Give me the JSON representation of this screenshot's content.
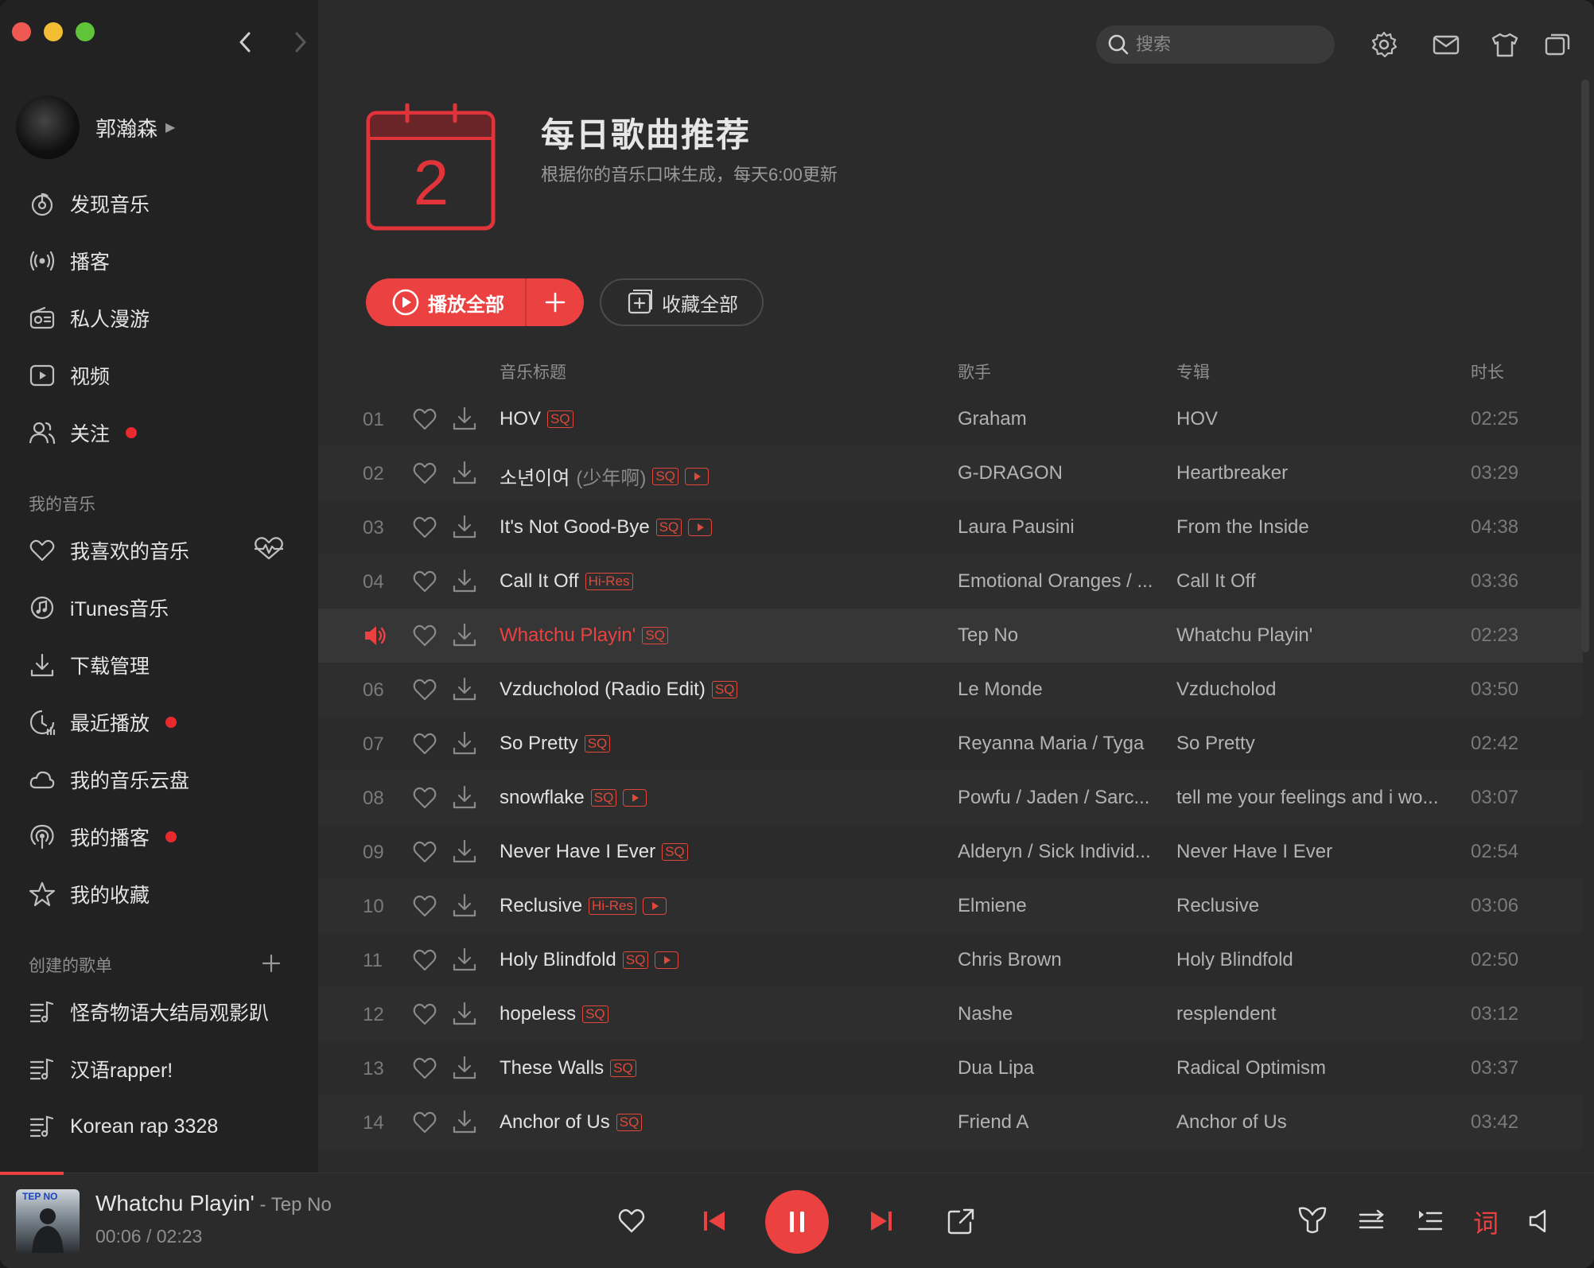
{
  "colors": {
    "accent": "#ec4141",
    "sidebar_bg": "#222222",
    "main_bg": "#2b2b2b",
    "text_primary": "#e2e2e2",
    "text_secondary": "#9a9a9a"
  },
  "titlebar": {
    "search_placeholder": "搜索",
    "icons": [
      "back-arrow-icon",
      "forward-arrow-icon",
      "settings-icon",
      "mail-icon",
      "skin-icon",
      "mini-mode-icon"
    ]
  },
  "sidebar": {
    "user_name": "郭瀚森",
    "nav": [
      {
        "label": "发现音乐",
        "icon": "discover-icon",
        "dot": false
      },
      {
        "label": "播客",
        "icon": "podcast-icon",
        "dot": false
      },
      {
        "label": "私人漫游",
        "icon": "radio-icon",
        "dot": false
      },
      {
        "label": "视频",
        "icon": "video-icon",
        "dot": false
      },
      {
        "label": "关注",
        "icon": "follow-icon",
        "dot": true
      }
    ],
    "my_music_label": "我的音乐",
    "my_music": [
      {
        "label": "我喜欢的音乐",
        "icon": "heart-icon",
        "dot": false
      },
      {
        "label": "iTunes音乐",
        "icon": "itunes-icon",
        "dot": false
      },
      {
        "label": "下载管理",
        "icon": "download-icon",
        "dot": false
      },
      {
        "label": "最近播放",
        "icon": "recent-icon",
        "dot": true
      },
      {
        "label": "我的音乐云盘",
        "icon": "cloud-icon",
        "dot": false
      },
      {
        "label": "我的播客",
        "icon": "my-podcast-icon",
        "dot": true
      },
      {
        "label": "我的收藏",
        "icon": "star-icon",
        "dot": false
      }
    ],
    "created_label": "创建的歌单",
    "playlists": [
      {
        "label": "怪奇物语大结局观影趴"
      },
      {
        "label": "汉语rapper!"
      },
      {
        "label": "Korean rap  3328"
      }
    ]
  },
  "header": {
    "calendar_day": "2",
    "title": "每日歌曲推荐",
    "subtitle": "根据你的音乐口味生成，每天6:00更新",
    "play_all_label": "播放全部",
    "collect_all_label": "收藏全部"
  },
  "table": {
    "columns": {
      "title": "音乐标题",
      "artist": "歌手",
      "album": "专辑",
      "duration": "时长"
    },
    "rows": [
      {
        "num": "01",
        "title": "HOV",
        "alias": "",
        "tag": "SQ",
        "mv": false,
        "artist": "Graham",
        "album": "HOV",
        "duration": "02:25",
        "playing": false
      },
      {
        "num": "02",
        "title": "소년이여",
        "alias": "(少年啊)",
        "tag": "SQ",
        "mv": true,
        "artist": "G-DRAGON",
        "album": "Heartbreaker",
        "duration": "03:29",
        "playing": false
      },
      {
        "num": "03",
        "title": "It's Not Good-Bye",
        "alias": "",
        "tag": "SQ",
        "mv": true,
        "artist": "Laura Pausini",
        "album": "From the Inside",
        "duration": "04:38",
        "playing": false
      },
      {
        "num": "04",
        "title": "Call It Off",
        "alias": "",
        "tag": "Hi-Res",
        "mv": false,
        "artist": "Emotional Oranges / ...",
        "album": "Call It Off",
        "duration": "03:36",
        "playing": false
      },
      {
        "num": "05",
        "title": "Whatchu Playin'",
        "alias": "",
        "tag": "SQ",
        "mv": false,
        "artist": "Tep No",
        "album": "Whatchu Playin'",
        "duration": "02:23",
        "playing": true
      },
      {
        "num": "06",
        "title": "Vzducholod (Radio Edit)",
        "alias": "",
        "tag": "SQ",
        "mv": false,
        "artist": "Le Monde",
        "album": "Vzducholod",
        "duration": "03:50",
        "playing": false
      },
      {
        "num": "07",
        "title": "So Pretty",
        "alias": "",
        "tag": "SQ",
        "mv": false,
        "artist": "Reyanna Maria / Tyga",
        "album": "So Pretty",
        "duration": "02:42",
        "playing": false
      },
      {
        "num": "08",
        "title": "snowflake",
        "alias": "",
        "tag": "SQ",
        "mv": true,
        "artist": "Powfu / Jaden / Sarc...",
        "album": "tell me your feelings and i wo...",
        "duration": "03:07",
        "playing": false
      },
      {
        "num": "09",
        "title": "Never Have I Ever",
        "alias": "",
        "tag": "SQ",
        "mv": false,
        "artist": "Alderyn / Sick Individ...",
        "album": "Never Have I Ever",
        "duration": "02:54",
        "playing": false
      },
      {
        "num": "10",
        "title": "Reclusive",
        "alias": "",
        "tag": "Hi-Res",
        "mv": true,
        "artist": "Elmiene",
        "album": "Reclusive",
        "duration": "03:06",
        "playing": false
      },
      {
        "num": "11",
        "title": "Holy Blindfold",
        "alias": "",
        "tag": "SQ",
        "mv": true,
        "artist": "Chris Brown",
        "album": "Holy Blindfold",
        "duration": "02:50",
        "playing": false
      },
      {
        "num": "12",
        "title": "hopeless",
        "alias": "",
        "tag": "SQ",
        "mv": false,
        "artist": "Nashe",
        "album": "resplendent",
        "duration": "03:12",
        "playing": false
      },
      {
        "num": "13",
        "title": "These Walls",
        "alias": "",
        "tag": "SQ",
        "mv": false,
        "artist": "Dua Lipa",
        "album": "Radical Optimism",
        "duration": "03:37",
        "playing": false
      },
      {
        "num": "14",
        "title": "Anchor of Us",
        "alias": "",
        "tag": "SQ",
        "mv": false,
        "artist": "Friend A",
        "album": "Anchor of Us",
        "duration": "03:42",
        "playing": false
      }
    ]
  },
  "player": {
    "cover_text": "TEP NO",
    "title": "Whatchu Playin'",
    "separator": " - ",
    "artist": "Tep No",
    "current_time": "00:06",
    "time_sep": " / ",
    "total_time": "02:23",
    "progress": 0.04,
    "lyrics_label": "词"
  }
}
